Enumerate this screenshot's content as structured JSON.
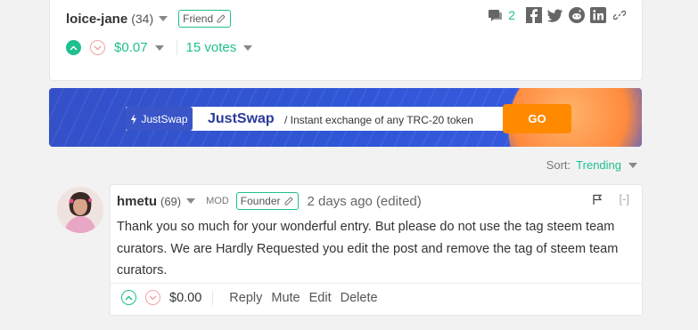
{
  "post": {
    "author": "loice-jane",
    "reputation": "(34)",
    "badge": "Friend",
    "comment_count": "2",
    "payout": "$0.07",
    "votes": "15 votes"
  },
  "banner": {
    "chip_label": "JustSwap",
    "title": "JustSwap",
    "tagline": "/ Instant exchange of any TRC-20 token",
    "cta": "GO"
  },
  "sort": {
    "label": "Sort:",
    "value": "Trending"
  },
  "comment": {
    "author": "hmetu",
    "reputation": "(69)",
    "mod": "MOD",
    "badge": "Founder",
    "time": "2 days ago",
    "edited": "(edited)",
    "collapse": "[-]",
    "body": "Thank you so much for your wonderful entry. But please do not use the tag steem team curators. We are Hardly Requested you edit the post and remove the tag of steem team curators.",
    "payout": "$0.00",
    "actions": {
      "reply": "Reply",
      "mute": "Mute",
      "edit": "Edit",
      "delete": "Delete"
    }
  },
  "colors": {
    "accent": "#1fbf8f",
    "downvote": "#f4a4a4",
    "banner_blue": "#3450c9",
    "cta_orange": "#ff8a00"
  }
}
